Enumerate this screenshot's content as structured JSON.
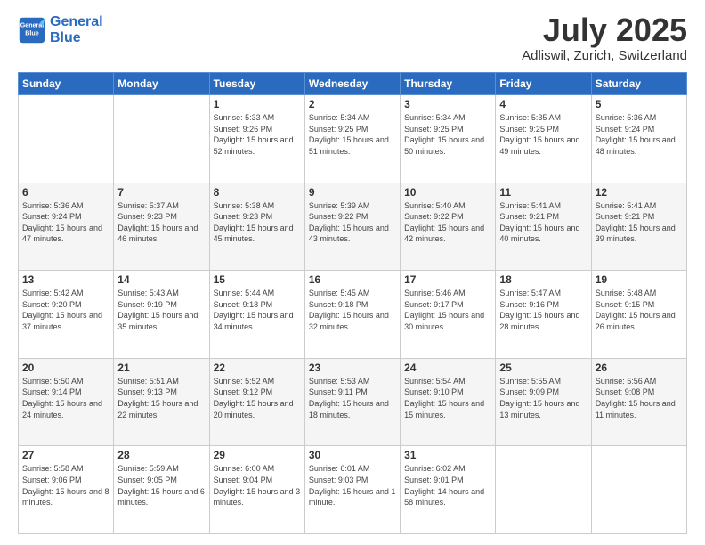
{
  "header": {
    "logo_line1": "General",
    "logo_line2": "Blue",
    "month": "July 2025",
    "location": "Adliswil, Zurich, Switzerland"
  },
  "days_of_week": [
    "Sunday",
    "Monday",
    "Tuesday",
    "Wednesday",
    "Thursday",
    "Friday",
    "Saturday"
  ],
  "weeks": [
    [
      {
        "day": "",
        "sunrise": "",
        "sunset": "",
        "daylight": ""
      },
      {
        "day": "",
        "sunrise": "",
        "sunset": "",
        "daylight": ""
      },
      {
        "day": "1",
        "sunrise": "Sunrise: 5:33 AM",
        "sunset": "Sunset: 9:26 PM",
        "daylight": "Daylight: 15 hours and 52 minutes."
      },
      {
        "day": "2",
        "sunrise": "Sunrise: 5:34 AM",
        "sunset": "Sunset: 9:25 PM",
        "daylight": "Daylight: 15 hours and 51 minutes."
      },
      {
        "day": "3",
        "sunrise": "Sunrise: 5:34 AM",
        "sunset": "Sunset: 9:25 PM",
        "daylight": "Daylight: 15 hours and 50 minutes."
      },
      {
        "day": "4",
        "sunrise": "Sunrise: 5:35 AM",
        "sunset": "Sunset: 9:25 PM",
        "daylight": "Daylight: 15 hours and 49 minutes."
      },
      {
        "day": "5",
        "sunrise": "Sunrise: 5:36 AM",
        "sunset": "Sunset: 9:24 PM",
        "daylight": "Daylight: 15 hours and 48 minutes."
      }
    ],
    [
      {
        "day": "6",
        "sunrise": "Sunrise: 5:36 AM",
        "sunset": "Sunset: 9:24 PM",
        "daylight": "Daylight: 15 hours and 47 minutes."
      },
      {
        "day": "7",
        "sunrise": "Sunrise: 5:37 AM",
        "sunset": "Sunset: 9:23 PM",
        "daylight": "Daylight: 15 hours and 46 minutes."
      },
      {
        "day": "8",
        "sunrise": "Sunrise: 5:38 AM",
        "sunset": "Sunset: 9:23 PM",
        "daylight": "Daylight: 15 hours and 45 minutes."
      },
      {
        "day": "9",
        "sunrise": "Sunrise: 5:39 AM",
        "sunset": "Sunset: 9:22 PM",
        "daylight": "Daylight: 15 hours and 43 minutes."
      },
      {
        "day": "10",
        "sunrise": "Sunrise: 5:40 AM",
        "sunset": "Sunset: 9:22 PM",
        "daylight": "Daylight: 15 hours and 42 minutes."
      },
      {
        "day": "11",
        "sunrise": "Sunrise: 5:41 AM",
        "sunset": "Sunset: 9:21 PM",
        "daylight": "Daylight: 15 hours and 40 minutes."
      },
      {
        "day": "12",
        "sunrise": "Sunrise: 5:41 AM",
        "sunset": "Sunset: 9:21 PM",
        "daylight": "Daylight: 15 hours and 39 minutes."
      }
    ],
    [
      {
        "day": "13",
        "sunrise": "Sunrise: 5:42 AM",
        "sunset": "Sunset: 9:20 PM",
        "daylight": "Daylight: 15 hours and 37 minutes."
      },
      {
        "day": "14",
        "sunrise": "Sunrise: 5:43 AM",
        "sunset": "Sunset: 9:19 PM",
        "daylight": "Daylight: 15 hours and 35 minutes."
      },
      {
        "day": "15",
        "sunrise": "Sunrise: 5:44 AM",
        "sunset": "Sunset: 9:18 PM",
        "daylight": "Daylight: 15 hours and 34 minutes."
      },
      {
        "day": "16",
        "sunrise": "Sunrise: 5:45 AM",
        "sunset": "Sunset: 9:18 PM",
        "daylight": "Daylight: 15 hours and 32 minutes."
      },
      {
        "day": "17",
        "sunrise": "Sunrise: 5:46 AM",
        "sunset": "Sunset: 9:17 PM",
        "daylight": "Daylight: 15 hours and 30 minutes."
      },
      {
        "day": "18",
        "sunrise": "Sunrise: 5:47 AM",
        "sunset": "Sunset: 9:16 PM",
        "daylight": "Daylight: 15 hours and 28 minutes."
      },
      {
        "day": "19",
        "sunrise": "Sunrise: 5:48 AM",
        "sunset": "Sunset: 9:15 PM",
        "daylight": "Daylight: 15 hours and 26 minutes."
      }
    ],
    [
      {
        "day": "20",
        "sunrise": "Sunrise: 5:50 AM",
        "sunset": "Sunset: 9:14 PM",
        "daylight": "Daylight: 15 hours and 24 minutes."
      },
      {
        "day": "21",
        "sunrise": "Sunrise: 5:51 AM",
        "sunset": "Sunset: 9:13 PM",
        "daylight": "Daylight: 15 hours and 22 minutes."
      },
      {
        "day": "22",
        "sunrise": "Sunrise: 5:52 AM",
        "sunset": "Sunset: 9:12 PM",
        "daylight": "Daylight: 15 hours and 20 minutes."
      },
      {
        "day": "23",
        "sunrise": "Sunrise: 5:53 AM",
        "sunset": "Sunset: 9:11 PM",
        "daylight": "Daylight: 15 hours and 18 minutes."
      },
      {
        "day": "24",
        "sunrise": "Sunrise: 5:54 AM",
        "sunset": "Sunset: 9:10 PM",
        "daylight": "Daylight: 15 hours and 15 minutes."
      },
      {
        "day": "25",
        "sunrise": "Sunrise: 5:55 AM",
        "sunset": "Sunset: 9:09 PM",
        "daylight": "Daylight: 15 hours and 13 minutes."
      },
      {
        "day": "26",
        "sunrise": "Sunrise: 5:56 AM",
        "sunset": "Sunset: 9:08 PM",
        "daylight": "Daylight: 15 hours and 11 minutes."
      }
    ],
    [
      {
        "day": "27",
        "sunrise": "Sunrise: 5:58 AM",
        "sunset": "Sunset: 9:06 PM",
        "daylight": "Daylight: 15 hours and 8 minutes."
      },
      {
        "day": "28",
        "sunrise": "Sunrise: 5:59 AM",
        "sunset": "Sunset: 9:05 PM",
        "daylight": "Daylight: 15 hours and 6 minutes."
      },
      {
        "day": "29",
        "sunrise": "Sunrise: 6:00 AM",
        "sunset": "Sunset: 9:04 PM",
        "daylight": "Daylight: 15 hours and 3 minutes."
      },
      {
        "day": "30",
        "sunrise": "Sunrise: 6:01 AM",
        "sunset": "Sunset: 9:03 PM",
        "daylight": "Daylight: 15 hours and 1 minute."
      },
      {
        "day": "31",
        "sunrise": "Sunrise: 6:02 AM",
        "sunset": "Sunset: 9:01 PM",
        "daylight": "Daylight: 14 hours and 58 minutes."
      },
      {
        "day": "",
        "sunrise": "",
        "sunset": "",
        "daylight": ""
      },
      {
        "day": "",
        "sunrise": "",
        "sunset": "",
        "daylight": ""
      }
    ]
  ]
}
